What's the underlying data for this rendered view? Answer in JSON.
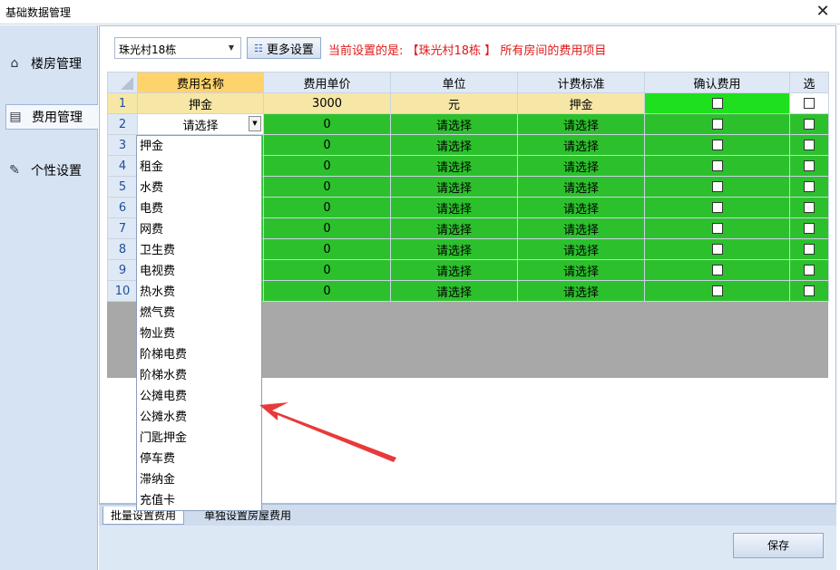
{
  "window": {
    "title": "基础数据管理",
    "close_glyph": "✕"
  },
  "sidebar": {
    "items": [
      {
        "label": "楼房管理",
        "icon": "home-icon"
      },
      {
        "label": "费用管理",
        "icon": "fee-list-icon"
      },
      {
        "label": "个性设置",
        "icon": "settings-icon"
      }
    ],
    "active_index": 1
  },
  "toolbar": {
    "building_select": "珠光村18栋",
    "more_settings_label": "更多设置",
    "current_label": "当前设置的是: 【珠光村18栋 】 所有房间的费用项目"
  },
  "grid": {
    "headers": [
      "费用名称",
      "费用单价",
      "单位",
      "计费标准",
      "确认费用",
      "选"
    ],
    "rows": [
      {
        "no": "1",
        "name": "押金",
        "price": "3000",
        "unit": "元",
        "standard": "押金"
      },
      {
        "no": "2",
        "name": "请选择",
        "price": "0",
        "unit": "请选择",
        "standard": "请选择"
      },
      {
        "no": "3",
        "name": "",
        "price": "0",
        "unit": "请选择",
        "standard": "请选择"
      },
      {
        "no": "4",
        "name": "",
        "price": "0",
        "unit": "请选择",
        "standard": "请选择"
      },
      {
        "no": "5",
        "name": "",
        "price": "0",
        "unit": "请选择",
        "standard": "请选择"
      },
      {
        "no": "6",
        "name": "",
        "price": "0",
        "unit": "请选择",
        "standard": "请选择"
      },
      {
        "no": "7",
        "name": "",
        "price": "0",
        "unit": "请选择",
        "standard": "请选择"
      },
      {
        "no": "8",
        "name": "",
        "price": "0",
        "unit": "请选择",
        "standard": "请选择"
      },
      {
        "no": "9",
        "name": "",
        "price": "0",
        "unit": "请选择",
        "standard": "请选择"
      },
      {
        "no": "10",
        "name": "",
        "price": "0",
        "unit": "请选择",
        "standard": "请选择"
      }
    ]
  },
  "dropdown": {
    "options": [
      "押金",
      "租金",
      "水费",
      "电费",
      "网费",
      "卫生费",
      "电视费",
      "热水费",
      "燃气费",
      "物业费",
      "阶梯电费",
      "阶梯水费",
      "公摊电费",
      "公摊水费",
      "门匙押金",
      "停车费",
      "滞纳金",
      "充值卡"
    ]
  },
  "tabs": {
    "batch": "批量设置费用",
    "single": "单独设置房屋费用"
  },
  "footer": {
    "save_label": "保存"
  },
  "colors": {
    "grid_green": "#2cc12c",
    "confirm_green": "#1fe01f",
    "highlight_row": "#f6e7a6",
    "annotation_arrow": "#e83a3a"
  }
}
